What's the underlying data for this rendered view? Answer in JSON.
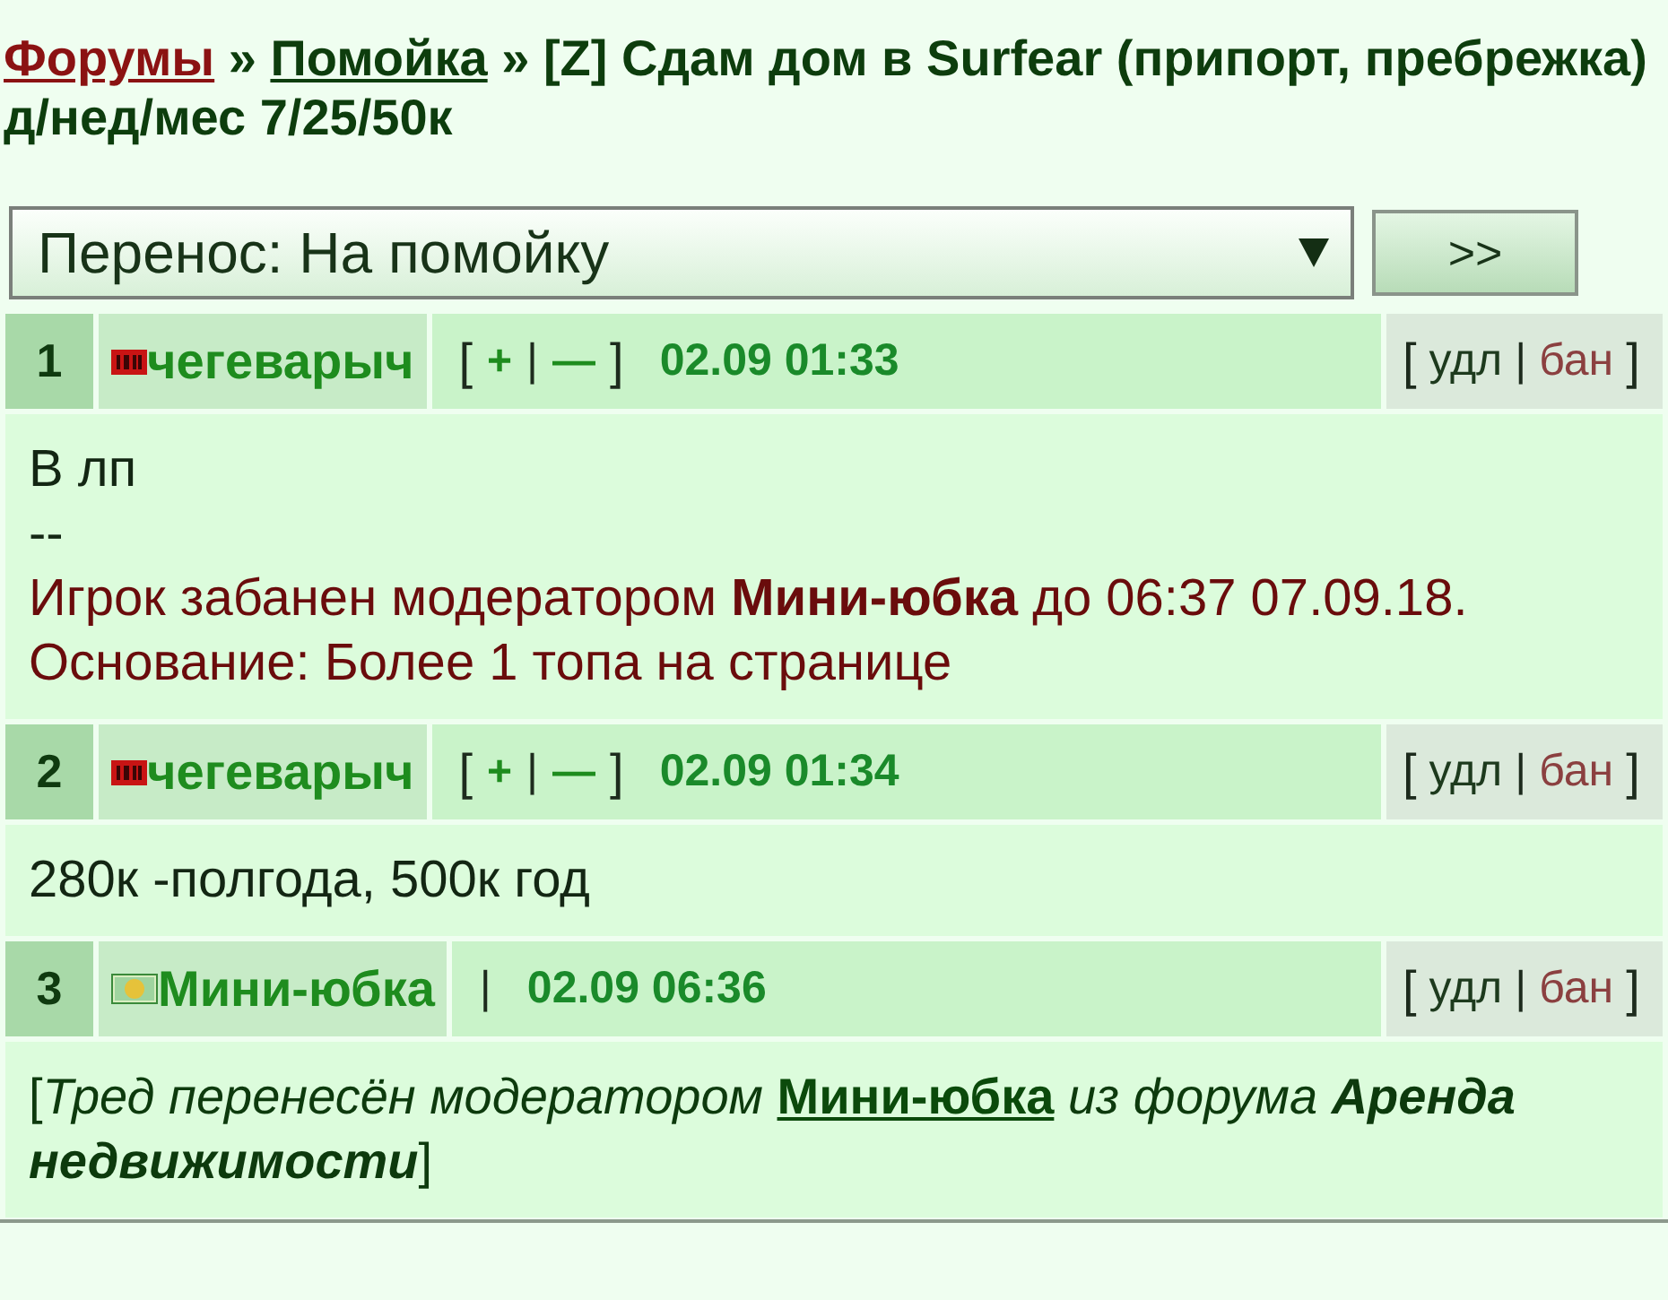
{
  "breadcrumb": [
    {
      "kind": "root_link",
      "text": "Форумы"
    },
    {
      "kind": "separator",
      "text": "»"
    },
    {
      "kind": "link",
      "text": "Помойка"
    },
    {
      "kind": "separator",
      "text": "»"
    },
    {
      "kind": "title",
      "text": "[Z] Сдам дом в Surfear (припорт, пребрежка) д/нед/мес 7/25/50к"
    }
  ],
  "move_form": {
    "select": {
      "value": "Перенос: На помойку"
    },
    "submit": ">>"
  },
  "posts": [
    {
      "number": "1",
      "author": {
        "avatar": {
          "kind": "badge"
        },
        "name": "чегеварыч"
      },
      "meta": [
        {
          "kind": "bracket",
          "text": "["
        },
        {
          "kind": "vote",
          "text": "+"
        },
        {
          "kind": "separator",
          "text": "|"
        },
        {
          "kind": "vote",
          "text": "—"
        },
        {
          "kind": "bracket",
          "text": "]"
        },
        {
          "kind": "date",
          "text": "02.09 01:33"
        }
      ],
      "actions": [
        {
          "kind": "bracket",
          "text": "["
        },
        {
          "kind": "delete",
          "text": "удл"
        },
        {
          "kind": "separator",
          "text": "|"
        },
        {
          "kind": "ban",
          "text": "бан"
        },
        {
          "kind": "bracket",
          "text": "]"
        }
      ],
      "body": [
        {
          "kind": "text",
          "text": "В лп"
        },
        {
          "kind": "text",
          "text": "--"
        },
        {
          "kind": "ban",
          "text": "Игрок забанен модератором **Мини-юбка** до 06:37 07.09.18."
        },
        {
          "kind": "ban",
          "text": "Основание: Более 1 топа на странице"
        }
      ]
    },
    {
      "number": "2",
      "author": {
        "avatar": {
          "kind": "badge"
        },
        "name": "чегеварыч"
      },
      "meta": [
        {
          "kind": "bracket",
          "text": "["
        },
        {
          "kind": "vote",
          "text": "+"
        },
        {
          "kind": "separator",
          "text": "|"
        },
        {
          "kind": "vote",
          "text": "—"
        },
        {
          "kind": "bracket",
          "text": "]"
        },
        {
          "kind": "date",
          "text": "02.09 01:34"
        }
      ],
      "actions": [
        {
          "kind": "bracket",
          "text": "["
        },
        {
          "kind": "delete",
          "text": "удл"
        },
        {
          "kind": "separator",
          "text": "|"
        },
        {
          "kind": "ban",
          "text": "бан"
        },
        {
          "kind": "bracket",
          "text": "]"
        }
      ],
      "body": [
        {
          "kind": "text",
          "text": "280к -полгода, 500к год"
        }
      ]
    },
    {
      "number": "3",
      "author": {
        "avatar": {
          "kind": "picture"
        },
        "name": "Мини-юбка"
      },
      "meta": [
        {
          "kind": "separator",
          "text": "|"
        },
        {
          "kind": "date",
          "text": "02.09 06:36"
        }
      ],
      "actions": [
        {
          "kind": "bracket",
          "text": "["
        },
        {
          "kind": "delete",
          "text": "удл"
        },
        {
          "kind": "separator",
          "text": "|"
        },
        {
          "kind": "ban",
          "text": "бан"
        },
        {
          "kind": "bracket",
          "text": "]"
        }
      ],
      "body": [
        {
          "kind": "moved",
          "segments": [
            {
              "kind": "plain",
              "text": "["
            },
            {
              "kind": "italic",
              "text": "Тред перенесён модератором "
            },
            {
              "kind": "link",
              "text": "Мини-юбка"
            },
            {
              "kind": "italic",
              "text": " из форума "
            },
            {
              "kind": "bold_italic",
              "text": "Аренда недвижимости"
            },
            {
              "kind": "plain",
              "text": "]"
            }
          ]
        }
      ]
    }
  ]
}
